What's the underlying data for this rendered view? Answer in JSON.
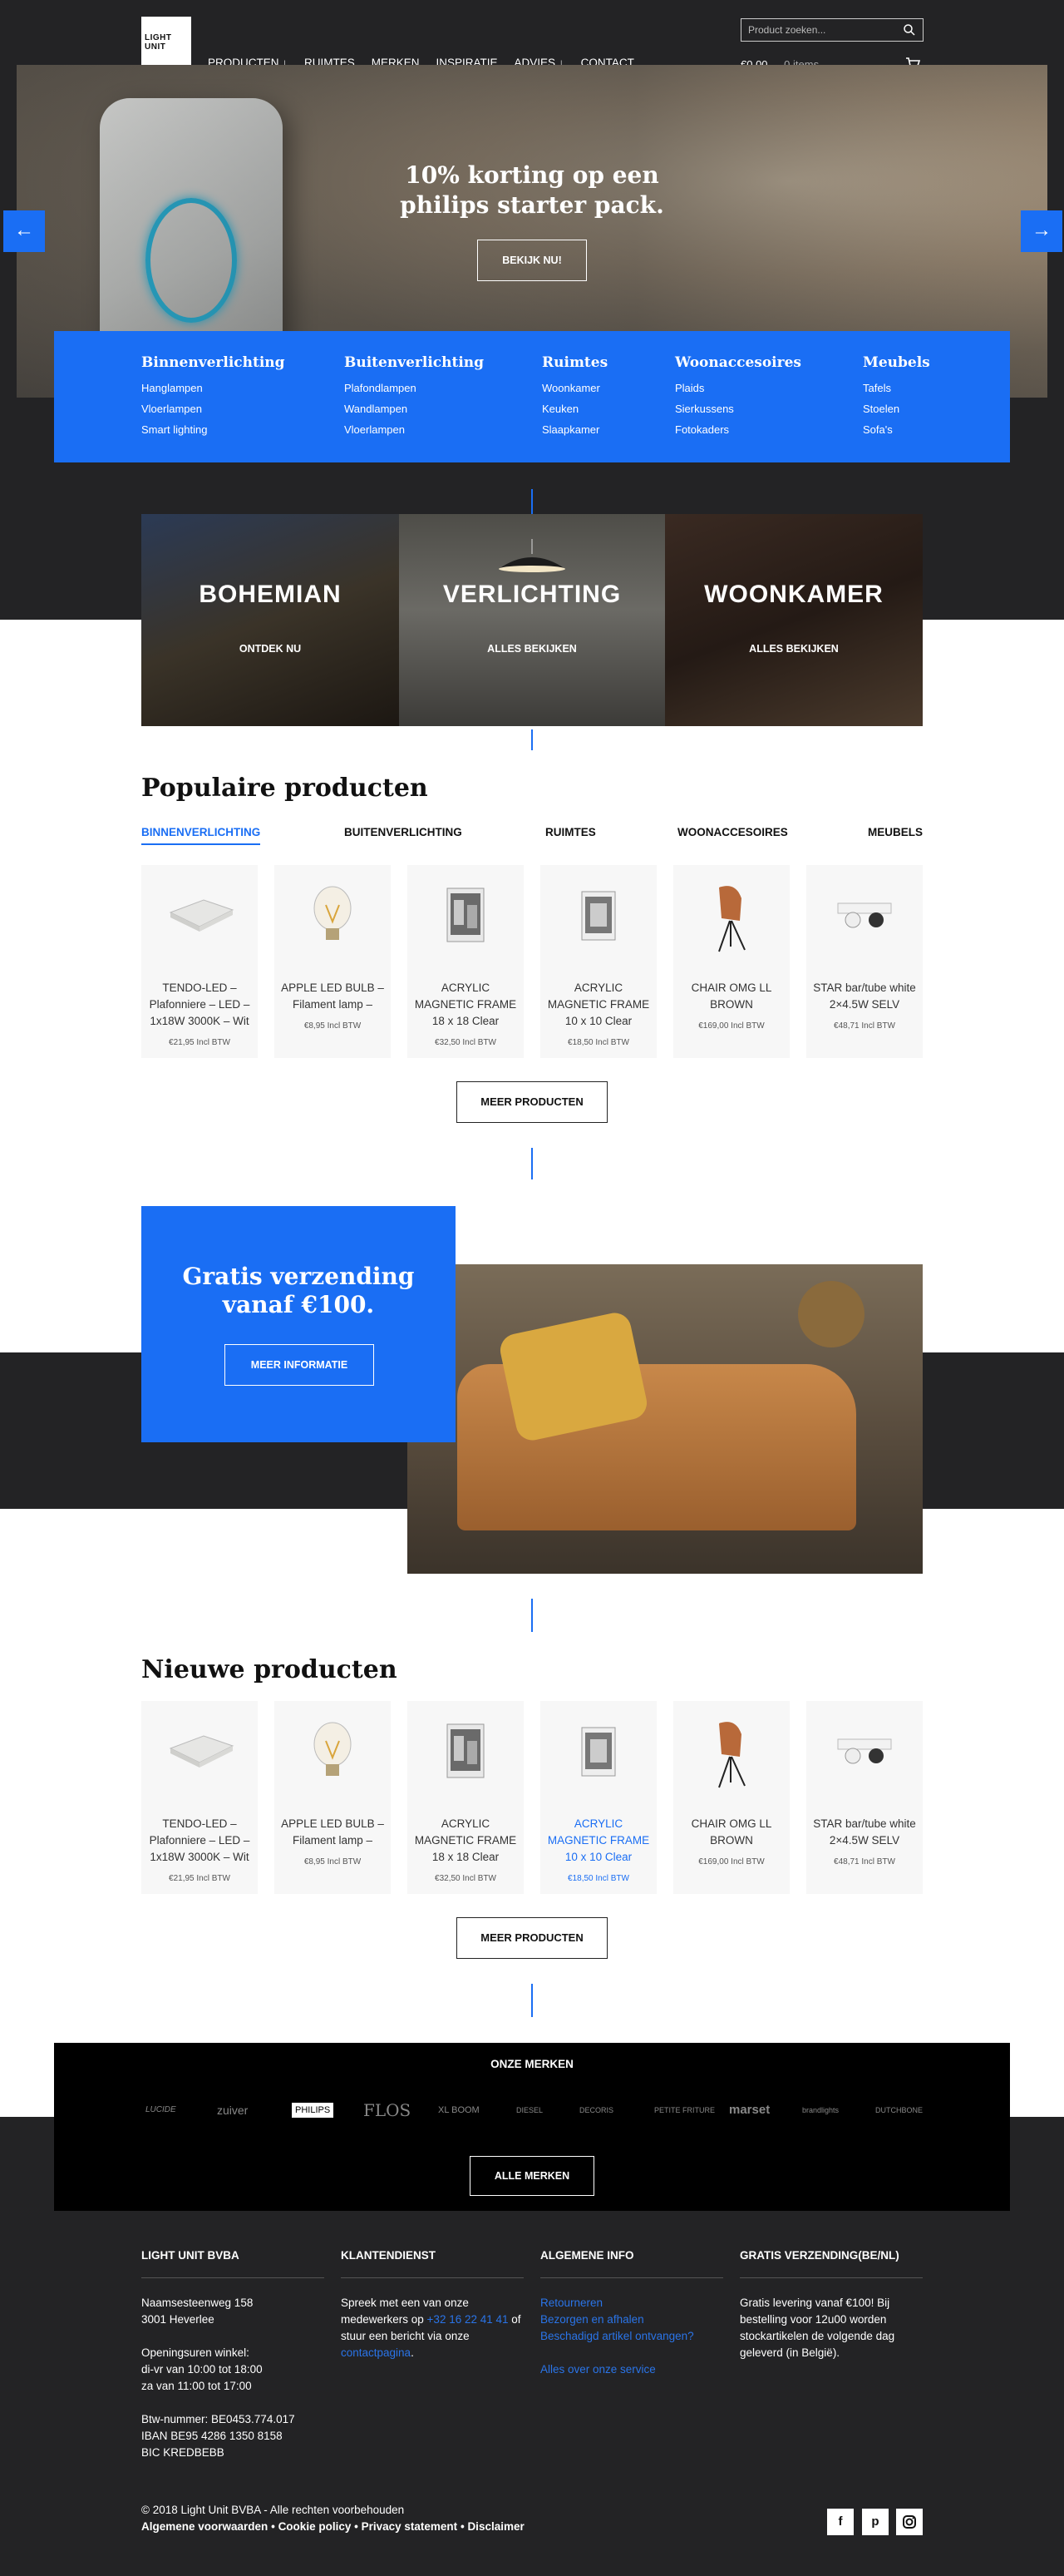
{
  "header": {
    "logo_text": "LIGHT UNIT",
    "nav": [
      "PRODUCTEN ↓",
      "RUIMTES",
      "MERKEN",
      "INSPIRATIE",
      "ADVIES ↓",
      "CONTACT"
    ],
    "search_placeholder": "Product zoeken...",
    "cart_total": "€0,00",
    "cart_items": "0 items"
  },
  "hero": {
    "title_line1": "10% korting op een",
    "title_line2": "philips starter pack.",
    "button": "BEKIJK NU!",
    "prev_arrow": "←",
    "next_arrow": "→"
  },
  "category_menu": [
    {
      "title": "Binnenverlichting",
      "items": [
        "Hanglampen",
        "Vloerlampen",
        "Smart lighting"
      ]
    },
    {
      "title": "Buitenverlichting",
      "items": [
        "Plafondlampen",
        "Wandlampen",
        "Vloerlampen"
      ]
    },
    {
      "title": "Ruimtes",
      "items": [
        "Woonkamer",
        "Keuken",
        "Slaapkamer"
      ]
    },
    {
      "title": "Woonaccesoires",
      "items": [
        "Plaids",
        "Sierkussens",
        "Fotokaders"
      ]
    },
    {
      "title": "Meubels",
      "items": [
        "Tafels",
        "Stoelen",
        "Sofa's"
      ]
    }
  ],
  "tiles": [
    {
      "title": "BOHEMIAN",
      "subtitle": "ONTDEK NU"
    },
    {
      "title": "VERLICHTING",
      "subtitle": "ALLES BEKIJKEN"
    },
    {
      "title": "WOONKAMER",
      "subtitle": "ALLES BEKIJKEN"
    }
  ],
  "popular": {
    "title": "Populaire producten",
    "tabs": [
      "BINNENVERLICHTING",
      "BUITENVERLICHTING",
      "RUIMTES",
      "WOONACCESOIRES",
      "MEUBELS"
    ],
    "more_button": "MEER PRODUCTEN"
  },
  "products": [
    {
      "name": "TENDO-LED – Plafonniere – LED – 1x18W 3000K – Wit",
      "price": "€21,95 Incl BTW"
    },
    {
      "name": "APPLE LED BULB – Filament lamp –",
      "price": "€8,95 Incl BTW"
    },
    {
      "name": "ACRYLIC MAGNETIC FRAME 18 x 18 Clear",
      "price": "€32,50 Incl BTW"
    },
    {
      "name": "ACRYLIC MAGNETIC FRAME 10 x 10 Clear",
      "price": "€18,50 Incl BTW"
    },
    {
      "name": "CHAIR OMG LL BROWN",
      "price": "€169,00 Incl BTW"
    },
    {
      "name": "STAR bar/tube white 2×4.5W SELV",
      "price": "€48,71 Incl BTW"
    }
  ],
  "shipping": {
    "title_line1": "Gratis verzending",
    "title_line2": "vanaf €100.",
    "button": "MEER INFORMATIE"
  },
  "new_products": {
    "title": "Nieuwe producten",
    "more_button": "MEER PRODUCTEN"
  },
  "brands": {
    "title": "ONZE MERKEN",
    "list": [
      "LUCIDE",
      "zuiver",
      "PHILIPS",
      "FLOS",
      "XL BOOM",
      "DIESEL",
      "DECORIS",
      "PETITE FRITURE",
      "marset",
      "brandlights",
      "DUTCHBONE"
    ],
    "button": "ALLE MERKEN"
  },
  "footer": {
    "col1": {
      "title": "LIGHT UNIT BVBA",
      "lines": [
        "Naamsesteenweg 158",
        "3001 Heverlee",
        "",
        "Openingsuren winkel:",
        "di-vr van 10:00 tot 18:00",
        "za van 11:00 tot 17:00",
        "",
        "Btw-nummer: BE0453.774.017",
        "IBAN BE95 4286 1350 8158",
        "BIC KREDBEBB"
      ]
    },
    "col2": {
      "title": "KLANTENDIENST",
      "text1": "Spreek met een van onze medewerkers op ",
      "phone": "+32 16 22 41 41",
      "text2": " of stuur een bericht via onze ",
      "link": "contactpagina",
      "text3": "."
    },
    "col3": {
      "title": "ALGEMENE INFO",
      "links": [
        "Retourneren",
        "Bezorgen en afhalen",
        "Beschadigd artikel ontvangen?"
      ],
      "extra": "Alles over onze service"
    },
    "col4": {
      "title": "GRATIS VERZENDING(BE/NL)",
      "text": "Gratis levering vanaf €100! Bij bestelling voor 12u00 worden stockartikelen de volgende dag geleverd (in België)."
    },
    "copyright": "© 2018 Light Unit BVBA - Alle rechten voorbehouden",
    "legal": [
      "Algemene voorwaarden",
      "Cookie policy",
      "Privacy statement",
      "Disclaimer"
    ],
    "social": [
      "f",
      "p",
      "instagram"
    ]
  },
  "colors": {
    "accent": "#1a6ef4",
    "dark": "#232325"
  }
}
